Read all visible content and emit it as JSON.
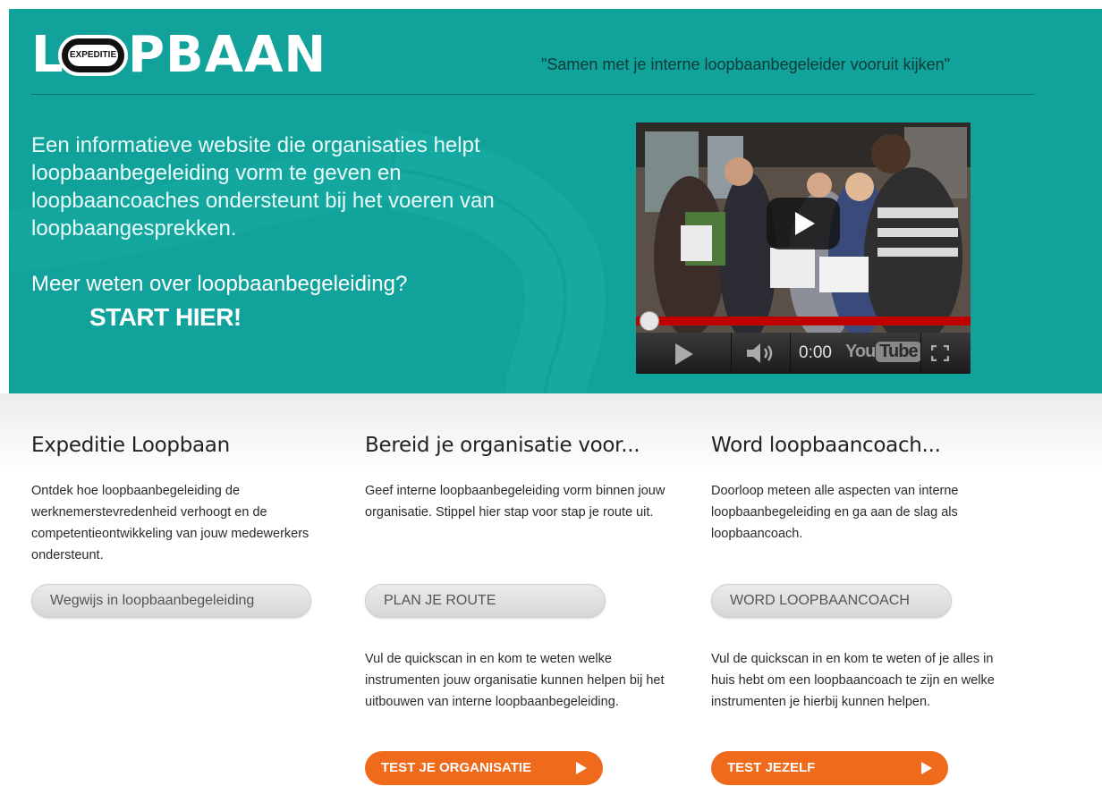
{
  "header": {
    "logo": {
      "letter_l": "L",
      "badge": "EXPEDITIE",
      "rest": "PBAAN"
    },
    "tagline": "\"Samen met je interne loopbaanbegeleider vooruit kijken\""
  },
  "hero": {
    "description": "Een informatieve website die organisaties helpt loopbaanbegeleiding vorm te geven en loopbaancoaches ondersteunt bij het voeren van loopbaangesprekken.",
    "more_question": "Meer weten over loopbaanbegeleiding?",
    "cta": "START HIER!"
  },
  "video": {
    "time": "0:00",
    "brand_you": "You",
    "brand_tube": "Tube",
    "progress": 0
  },
  "columns": [
    {
      "title": "Expeditie Loopbaan",
      "text": "Ontdek hoe loopbaanbegeleiding de werknemerstevredenheid verhoogt en de competentieontwikkeling van jouw medewerkers ondersteunt.",
      "button": "Wegwijs in loopbaanbegeleiding"
    },
    {
      "title": "Bereid je organisatie voor...",
      "text": "Geef interne loopbaanbegeleiding vorm binnen jouw organisatie. Stippel hier stap voor stap je route uit.",
      "button": "PLAN JE ROUTE",
      "quickscan_text": "Vul de quickscan in en kom te weten welke instrumenten jouw organisatie kunnen helpen bij het uitbouwen van interne loopbaanbegeleiding.",
      "quickscan_button": "TEST JE ORGANISATIE"
    },
    {
      "title": "Word loopbaancoach...",
      "text": "Doorloop meteen alle aspecten van interne loopbaanbegeleiding en ga aan de slag als loopbaancoach.",
      "button": "WORD LOOPBAANCOACH",
      "quickscan_text": "Vul de quickscan in en kom te weten of je alles in huis hebt om een loopbaancoach te zijn en welke instrumenten je hierbij kunnen helpen.",
      "quickscan_button": "TEST JEZELF"
    }
  ],
  "colors": {
    "hero_bg": "#11a39b",
    "accent_orange": "#ef6a1a",
    "youtube_red": "#c00000"
  }
}
